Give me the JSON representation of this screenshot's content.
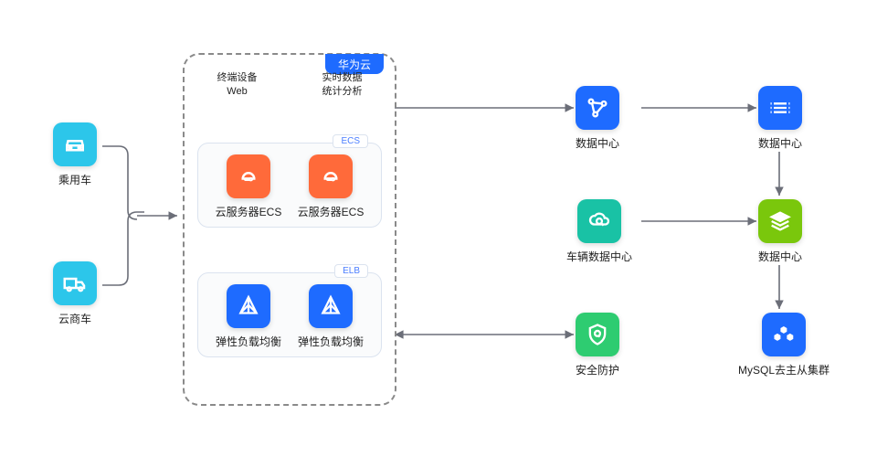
{
  "left": {
    "car": {
      "label": "乘用车"
    },
    "truck": {
      "label": "云商车"
    }
  },
  "main": {
    "tab": "华为云",
    "headers": [
      {
        "l1": "终端设备",
        "l2": "Web"
      },
      {
        "l1": "实时数据",
        "l2": "统计分析"
      }
    ],
    "ecs": {
      "tag": "ECS",
      "items": [
        "云服务器ECS",
        "云服务器ECS"
      ]
    },
    "elb": {
      "tag": "ELB",
      "items": [
        "弹性负载均衡",
        "弹性负载均衡"
      ]
    }
  },
  "right": {
    "r1a": {
      "label": "数据中心"
    },
    "r1b": {
      "label": "数据中心"
    },
    "r2a": {
      "label": "车辆数据中心"
    },
    "r2b": {
      "label": "数据中心"
    },
    "r3a": {
      "label": "安全防护"
    },
    "r3b": {
      "label": "MySQL去主从集群"
    }
  }
}
